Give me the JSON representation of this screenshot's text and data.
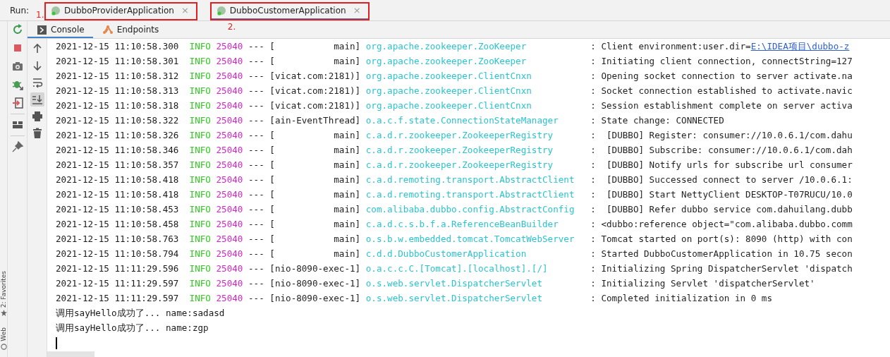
{
  "run_bar": {
    "label": "Run:",
    "tabs": [
      {
        "label": "DubboProviderApplication",
        "close": "×",
        "selected": false,
        "annotation": "1."
      },
      {
        "label": "DubboCustomerApplication",
        "close": "×",
        "selected": true,
        "annotation": "2."
      }
    ]
  },
  "sub_tabs": [
    {
      "label": "Console",
      "kind": "console",
      "selected": true
    },
    {
      "label": "Endpoints",
      "kind": "endpoints",
      "selected": false
    }
  ],
  "side_panel": [
    {
      "label": "2: Favorites",
      "kind": "star"
    },
    {
      "label": "Web",
      "kind": "globe"
    }
  ],
  "log": [
    {
      "time": "2021-12-15 11:10:58.300",
      "level": "INFO",
      "pid": "25040",
      "sep": "---",
      "thread": "[           main]",
      "logger": "org.apache.zookeeper.ZooKeeper",
      "message": ": Client environment:user.dir=",
      "link": "E:\\IDEA项目\\dubbo-z"
    },
    {
      "time": "2021-12-15 11:10:58.301",
      "level": "INFO",
      "pid": "25040",
      "sep": "---",
      "thread": "[           main]",
      "logger": "org.apache.zookeeper.ZooKeeper",
      "message": ": Initiating client connection, connectString=127"
    },
    {
      "time": "2021-12-15 11:10:58.312",
      "level": "INFO",
      "pid": "25040",
      "sep": "---",
      "thread": "[vicat.com:2181)]",
      "logger": "org.apache.zookeeper.ClientCnxn",
      "message": ": Opening socket connection to server activate.na"
    },
    {
      "time": "2021-12-15 11:10:58.313",
      "level": "INFO",
      "pid": "25040",
      "sep": "---",
      "thread": "[vicat.com:2181)]",
      "logger": "org.apache.zookeeper.ClientCnxn",
      "message": ": Socket connection established to activate.navic"
    },
    {
      "time": "2021-12-15 11:10:58.318",
      "level": "INFO",
      "pid": "25040",
      "sep": "---",
      "thread": "[vicat.com:2181)]",
      "logger": "org.apache.zookeeper.ClientCnxn",
      "message": ": Session establishment complete on server activa"
    },
    {
      "time": "2021-12-15 11:10:58.322",
      "level": "INFO",
      "pid": "25040",
      "sep": "---",
      "thread": "[ain-EventThread]",
      "logger": "o.a.c.f.state.ConnectionStateManager",
      "message": ": State change: CONNECTED"
    },
    {
      "time": "2021-12-15 11:10:58.326",
      "level": "INFO",
      "pid": "25040",
      "sep": "---",
      "thread": "[           main]",
      "logger": "c.a.d.r.zookeeper.ZookeeperRegistry",
      "message": ":  [DUBBO] Register: consumer://10.0.6.1/com.dahu"
    },
    {
      "time": "2021-12-15 11:10:58.346",
      "level": "INFO",
      "pid": "25040",
      "sep": "---",
      "thread": "[           main]",
      "logger": "c.a.d.r.zookeeper.ZookeeperRegistry",
      "message": ":  [DUBBO] Subscribe: consumer://10.0.6.1/com.dah"
    },
    {
      "time": "2021-12-15 11:10:58.357",
      "level": "INFO",
      "pid": "25040",
      "sep": "---",
      "thread": "[           main]",
      "logger": "c.a.d.r.zookeeper.ZookeeperRegistry",
      "message": ":  [DUBBO] Notify urls for subscribe url consumer"
    },
    {
      "time": "2021-12-15 11:10:58.418",
      "level": "INFO",
      "pid": "25040",
      "sep": "---",
      "thread": "[           main]",
      "logger": "c.a.d.remoting.transport.AbstractClient",
      "message": ":  [DUBBO] Successed connect to server /10.0.6.1:"
    },
    {
      "time": "2021-12-15 11:10:58.418",
      "level": "INFO",
      "pid": "25040",
      "sep": "---",
      "thread": "[           main]",
      "logger": "c.a.d.remoting.transport.AbstractClient",
      "message": ":  [DUBBO] Start NettyClient DESKTOP-T07RUCU/10.0"
    },
    {
      "time": "2021-12-15 11:10:58.453",
      "level": "INFO",
      "pid": "25040",
      "sep": "---",
      "thread": "[           main]",
      "logger": "com.alibaba.dubbo.config.AbstractConfig",
      "message": ":  [DUBBO] Refer dubbo service com.dahuilang.dubb"
    },
    {
      "time": "2021-12-15 11:10:58.458",
      "level": "INFO",
      "pid": "25040",
      "sep": "---",
      "thread": "[           main]",
      "logger": "c.a.d.c.s.b.f.a.ReferenceBeanBuilder",
      "message": ": <dubbo:reference object=\"com.alibaba.dubbo.comm"
    },
    {
      "time": "2021-12-15 11:10:58.763",
      "level": "INFO",
      "pid": "25040",
      "sep": "---",
      "thread": "[           main]",
      "logger": "o.s.b.w.embedded.tomcat.TomcatWebServer",
      "message": ": Tomcat started on port(s): 8090 (http) with con"
    },
    {
      "time": "2021-12-15 11:10:58.794",
      "level": "INFO",
      "pid": "25040",
      "sep": "---",
      "thread": "[           main]",
      "logger": "c.d.d.DubboCustomerApplication",
      "message": ": Started DubboCustomerApplication in 10.75 secon"
    },
    {
      "time": "2021-12-15 11:11:29.596",
      "level": "INFO",
      "pid": "25040",
      "sep": "---",
      "thread": "[nio-8090-exec-1]",
      "logger": "o.a.c.c.C.[Tomcat].[localhost].[/]",
      "message": ": Initializing Spring DispatcherServlet 'dispatch"
    },
    {
      "time": "2021-12-15 11:11:29.597",
      "level": "INFO",
      "pid": "25040",
      "sep": "---",
      "thread": "[nio-8090-exec-1]",
      "logger": "o.s.web.servlet.DispatcherServlet",
      "message": ": Initializing Servlet 'dispatcherServlet'"
    },
    {
      "time": "2021-12-15 11:11:29.597",
      "level": "INFO",
      "pid": "25040",
      "sep": "---",
      "thread": "[nio-8090-exec-1]",
      "logger": "o.s.web.servlet.DispatcherServlet",
      "message": ": Completed initialization in 0 ms"
    }
  ],
  "output_lines": [
    "调用sayHello成功了... name:sadasd",
    "调用sayHello成功了... name:zgp"
  ]
}
